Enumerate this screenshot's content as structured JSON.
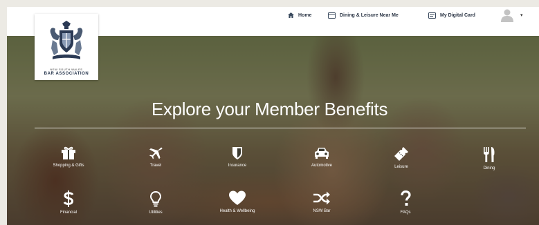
{
  "nav": {
    "home_label": "Home",
    "dining_label": "Dining & Leisure Near Me",
    "card_label": "My Digital Card",
    "caret": "▾"
  },
  "logo": {
    "small_text": "NEW SOUTH WALES",
    "large_text": "BAR ASSOCIATION"
  },
  "hero": {
    "title": "Explore your Member Benefits"
  },
  "benefits": [
    {
      "label": "Shopping & Gifts",
      "icon": "gift-icon"
    },
    {
      "label": "Travel",
      "icon": "plane-icon"
    },
    {
      "label": "Insurance",
      "icon": "shield-icon"
    },
    {
      "label": "Automotive",
      "icon": "car-icon"
    },
    {
      "label": "Leisure",
      "icon": "ticket-icon"
    },
    {
      "label": "Dining",
      "icon": "cutlery-icon"
    },
    {
      "label": "Financial",
      "icon": "dollar-icon"
    },
    {
      "label": "Utilities",
      "icon": "lightbulb-icon"
    },
    {
      "label": "Health & Wellbeing",
      "icon": "heart-icon"
    },
    {
      "label": "NSW Bar",
      "icon": "shuffle-icon"
    },
    {
      "label": "FAQs",
      "icon": "question-icon"
    }
  ],
  "colors": {
    "nav_text": "#2a3444",
    "nav_icon": "#3a4a5e",
    "overlay": "#19140f",
    "white": "#ffffff"
  }
}
